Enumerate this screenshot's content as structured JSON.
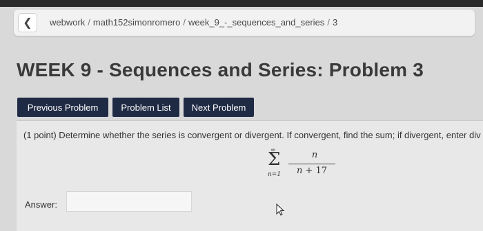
{
  "breadcrumb": {
    "back_icon": "chevron-left-icon",
    "items": [
      "webwork",
      "math152simonromero",
      "week_9_-_sequences_and_series",
      "3"
    ],
    "separator": "/"
  },
  "page": {
    "title": "WEEK 9 - Sequences and Series: Problem 3"
  },
  "nav": {
    "previous_label": "Previous Problem",
    "list_label": "Problem List",
    "next_label": "Next Problem"
  },
  "problem": {
    "text": "(1 point) Determine whether the series is convergent or divergent. If convergent, find the sum; if divergent, enter div",
    "formula": {
      "upper_limit": "∞",
      "sigma": "Σ",
      "lower_limit": "n=1",
      "numerator": "n",
      "denominator_var": "n",
      "denominator_rest": " + 17"
    },
    "answer_label": "Answer:",
    "answer_value": ""
  },
  "colors": {
    "nav_button_bg": "#1f2a44",
    "page_bg": "#d9d9d9"
  }
}
